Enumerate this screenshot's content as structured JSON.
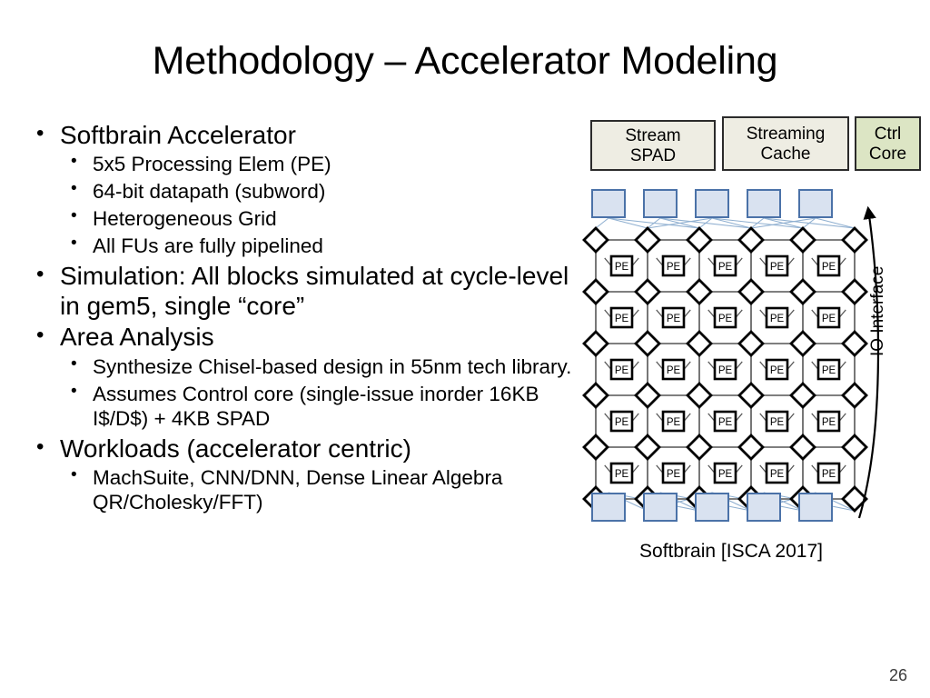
{
  "slide": {
    "title": "Methodology – Accelerator Modeling",
    "page_number": "26"
  },
  "bullets": [
    {
      "text": "Softbrain Accelerator",
      "sub": [
        "5x5 Processing Elem (PE)",
        "64-bit datapath (subword)",
        "Heterogeneous Grid",
        "All FUs are fully pipelined"
      ]
    },
    {
      "text": "Simulation: All blocks simulated at cycle-level in gem5, single “core”",
      "sub": []
    },
    {
      "text": "Area Analysis",
      "sub": [
        "Synthesize Chisel-based design in 55nm tech library.",
        "Assumes Control core (single-issue inorder 16KB I$/D$) + 4KB SPAD"
      ]
    },
    {
      "text": "Workloads (accelerator centric)",
      "sub": [
        "MachSuite, CNN/DNN, Dense Linear Algebra QR/Cholesky/FFT)"
      ]
    }
  ],
  "diagram": {
    "header_boxes": [
      {
        "name": "stream-spad",
        "line1": "Stream",
        "line2": "SPAD",
        "color": "#EEEDE3"
      },
      {
        "name": "streaming-cache",
        "line1": "Streaming",
        "line2": "Cache",
        "color": "#EEEDE3"
      },
      {
        "name": "ctrl-core",
        "line1": "Ctrl",
        "line2": "Core",
        "color": "#DCE5C4"
      }
    ],
    "io_interface_label": "IO Interface",
    "caption": "Softbrain [ISCA 2017]",
    "pe_label": "PE",
    "grid": {
      "pe_rows": 5,
      "pe_cols": 5,
      "switch_rows": 6,
      "switch_cols": 6,
      "top_io_blocks": 5,
      "bottom_io_blocks": 5
    },
    "colors": {
      "io_block_fill": "#D9E2F0",
      "io_block_border": "#4B72A8",
      "link_line": "#8FAFD0",
      "mesh_line": "#555555",
      "node_stroke": "#000000"
    }
  }
}
